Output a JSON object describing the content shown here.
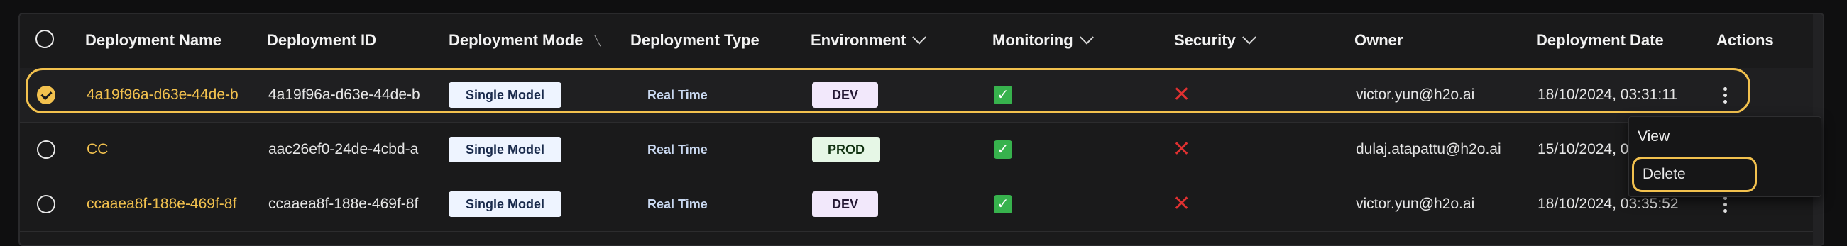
{
  "table": {
    "headers": {
      "deployment_name": "Deployment Name",
      "deployment_id": "Deployment ID",
      "deployment_mode": "Deployment Mode",
      "deployment_type": "Deployment Type",
      "environment": "Environment",
      "monitoring": "Monitoring",
      "security": "Security",
      "owner": "Owner",
      "deployment_date": "Deployment Date",
      "actions": "Actions"
    },
    "rows": [
      {
        "name": "4a19f96a-d63e-44de-b",
        "id": "4a19f96a-d63e-44de-b",
        "mode": "Single Model",
        "type": "Real Time",
        "environment": "DEV",
        "monitoring_icon": "check-icon",
        "security_icon": "cross-icon",
        "owner": "victor.yun@h2o.ai",
        "date": "18/10/2024, 03:31:11",
        "selected": true
      },
      {
        "name": "CC",
        "id": "aac26ef0-24de-4cbd-a",
        "mode": "Single Model",
        "type": "Real Time",
        "environment": "PROD",
        "monitoring_icon": "check-icon",
        "security_icon": "cross-icon",
        "owner": "dulaj.atapattu@h2o.ai",
        "date": "15/10/2024, 0",
        "selected": false
      },
      {
        "name": "ccaaea8f-188e-469f-8f",
        "id": "ccaaea8f-188e-469f-8f",
        "mode": "Single Model",
        "type": "Real Time",
        "environment": "DEV",
        "monitoring_icon": "check-icon",
        "security_icon": "cross-icon",
        "owner": "victor.yun@h2o.ai",
        "date": "18/10/2024, 03:35:52",
        "selected": false
      }
    ]
  },
  "actions_menu": {
    "view_label": "View",
    "delete_label": "Delete"
  },
  "colors": {
    "accent": "#f2c14e",
    "background": "#1a1a1b",
    "success": "#37b24d",
    "danger": "#e03131"
  }
}
